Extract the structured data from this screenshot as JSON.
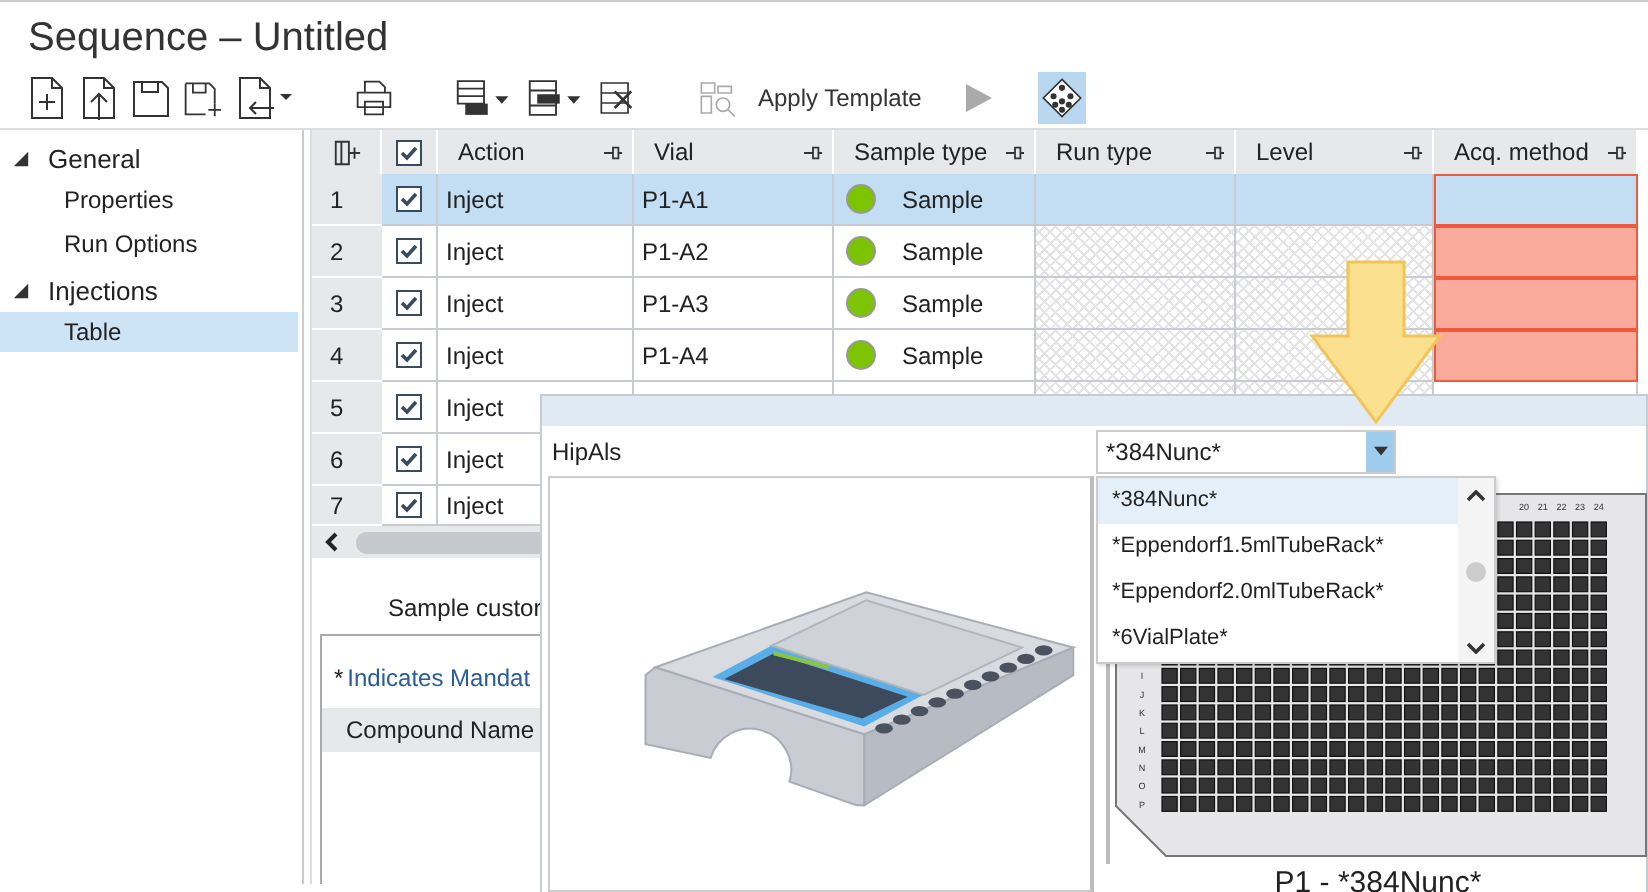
{
  "window": {
    "title": "Sequence – Untitled"
  },
  "toolbar": {
    "apply_template_label": "Apply Template",
    "apply_template_disabled": false,
    "template_icon_disabled": true,
    "run_disabled": true,
    "plate_view_selected": true
  },
  "sidebar": {
    "items": [
      {
        "label": "General",
        "expanded": true,
        "selected": false,
        "children": [
          {
            "label": "Properties",
            "selected": false
          },
          {
            "label": "Run Options",
            "selected": false
          }
        ]
      },
      {
        "label": "Injections",
        "expanded": true,
        "selected": false,
        "children": [
          {
            "label": "Table",
            "selected": true
          }
        ]
      }
    ]
  },
  "table": {
    "header_checked": true,
    "columns": [
      {
        "label": "Action",
        "hatched": false
      },
      {
        "label": "Vial",
        "hatched": false
      },
      {
        "label": "Sample type",
        "hatched": false
      },
      {
        "label": "Run type",
        "hatched": true
      },
      {
        "label": "Level",
        "hatched": true
      },
      {
        "label": "Acq. method",
        "hatched": false
      }
    ],
    "rows": [
      {
        "number": "1",
        "checked": true,
        "selected": true,
        "action": "Inject",
        "vial": "P1-A1",
        "sample_type": "Sample",
        "color": "#7cc400",
        "acq_error": true
      },
      {
        "number": "2",
        "checked": true,
        "selected": false,
        "action": "Inject",
        "vial": "P1-A2",
        "sample_type": "Sample",
        "color": "#7cc400",
        "acq_error": true
      },
      {
        "number": "3",
        "checked": true,
        "selected": false,
        "action": "Inject",
        "vial": "P1-A3",
        "sample_type": "Sample",
        "color": "#7cc400",
        "acq_error": true
      },
      {
        "number": "4",
        "checked": true,
        "selected": false,
        "action": "Inject",
        "vial": "P1-A4",
        "sample_type": "Sample",
        "color": "#7cc400",
        "acq_error": true
      },
      {
        "number": "5",
        "checked": true,
        "selected": false,
        "action": "Inject"
      },
      {
        "number": "6",
        "checked": true,
        "selected": false,
        "action": "Inject"
      },
      {
        "number": "7",
        "checked": true,
        "selected": false,
        "action": "Inject"
      }
    ]
  },
  "bottom_pane": {
    "tab": "Sample custor",
    "mandatory_mark": "*",
    "mandatory_note": "Indicates Mandat",
    "column": "Compound Name"
  },
  "popup": {
    "label": "HipAls",
    "combo_value": "*384Nunc*",
    "dropdown": [
      {
        "label": "*384Nunc*",
        "selected": true
      },
      {
        "label": "*Eppendorf1.5mlTubeRack*",
        "selected": false
      },
      {
        "label": "*Eppendorf2.0mlTubeRack*",
        "selected": false
      },
      {
        "label": "*6VialPlate*",
        "selected": false
      }
    ],
    "plate": {
      "column_labels": [
        "20",
        "21",
        "22",
        "23",
        "24"
      ],
      "row_labels": [
        "I",
        "J",
        "K",
        "L",
        "M",
        "N",
        "O",
        "P"
      ],
      "caption": "P1 - *384Nunc*"
    }
  }
}
